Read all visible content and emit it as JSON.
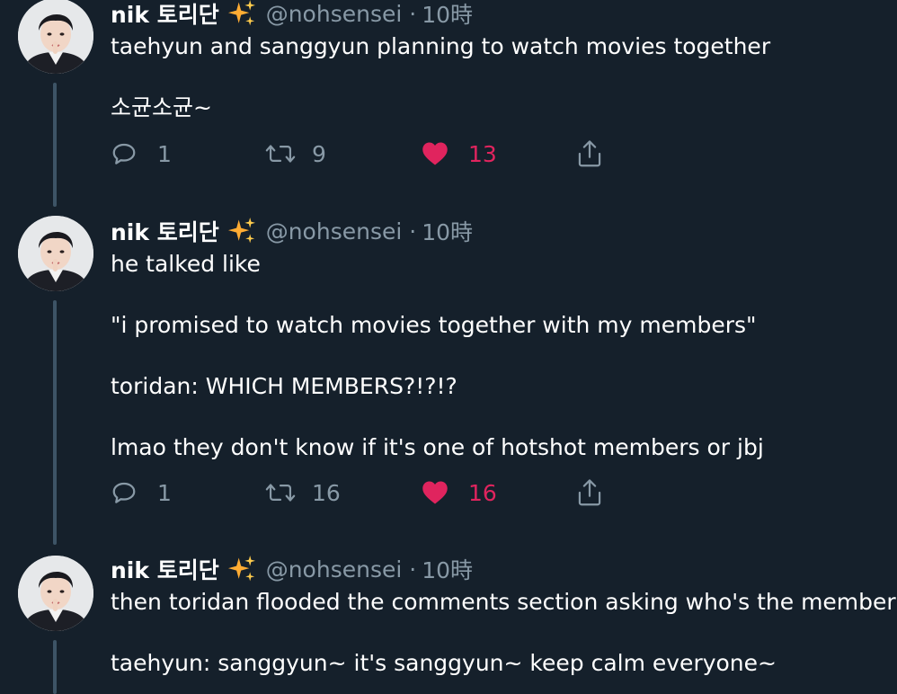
{
  "colors": {
    "background": "#15202b",
    "text_primary": "#ffffff",
    "text_secondary": "#8899a6",
    "like_active": "#e0245e",
    "thread_line": "#3d5466",
    "sparkle": "#ffac33"
  },
  "tweets": [
    {
      "author_name": "nik 토리단",
      "author_emoji": "sparkles-emoji",
      "handle": "@nohsensei",
      "separator": "·",
      "time": "10時",
      "paragraphs": [
        "taehyun and sanggyun planning to watch movies together",
        "소균소균~"
      ],
      "replies": "1",
      "retweets": "9",
      "likes": "13",
      "liked": true
    },
    {
      "author_name": "nik 토리단",
      "author_emoji": "sparkles-emoji",
      "handle": "@nohsensei",
      "separator": "·",
      "time": "10時",
      "paragraphs": [
        "he talked like",
        "\"i promised to watch movies together with my members\"",
        "toridan: WHICH MEMBERS?!?!?",
        "lmao they don't know if it's one of hotshot members or jbj"
      ],
      "replies": "1",
      "retweets": "16",
      "likes": "16",
      "liked": true
    },
    {
      "author_name": "nik 토리단",
      "author_emoji": "sparkles-emoji",
      "handle": "@nohsensei",
      "separator": "·",
      "time": "10時",
      "paragraphs": [
        "then toridan flooded the comments section asking who's the member",
        "taehyun: sanggyun~ it's sanggyun~ keep calm everyone~"
      ]
    }
  ]
}
